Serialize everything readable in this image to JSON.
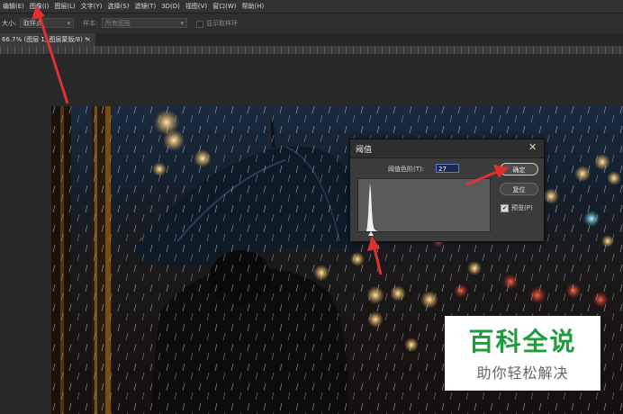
{
  "menu": {
    "items": [
      "编辑(E)",
      "图像(I)",
      "图层(L)",
      "文字(Y)",
      "选择(S)",
      "滤镜(T)",
      "3D(D)",
      "视图(V)",
      "窗口(W)",
      "帮助(H)"
    ]
  },
  "options_bar": {
    "size_label": "大小:",
    "size_value": "取样点",
    "sample_label": "样本:",
    "sample_value": "所有图层",
    "show_ring_label": "显示取样环"
  },
  "document_tab": {
    "title": "66.7% (图层 1, 图层蒙版/8) *",
    "close": "×"
  },
  "threshold_dialog": {
    "title": "阈值",
    "close": "✕",
    "level_label": "阈值色阶(T):",
    "level_value": "27",
    "ok_label": "确定",
    "reset_label": "复位",
    "preview_label": "预览(P)",
    "preview_checked": true,
    "preview_check_glyph": "✔"
  },
  "watermark": {
    "title": "百科全说",
    "subtitle": "助你轻松解决"
  },
  "colors": {
    "arrow": "#e03030",
    "watermark_green": "#1e9e3a",
    "input_border": "#5a7bd1"
  }
}
